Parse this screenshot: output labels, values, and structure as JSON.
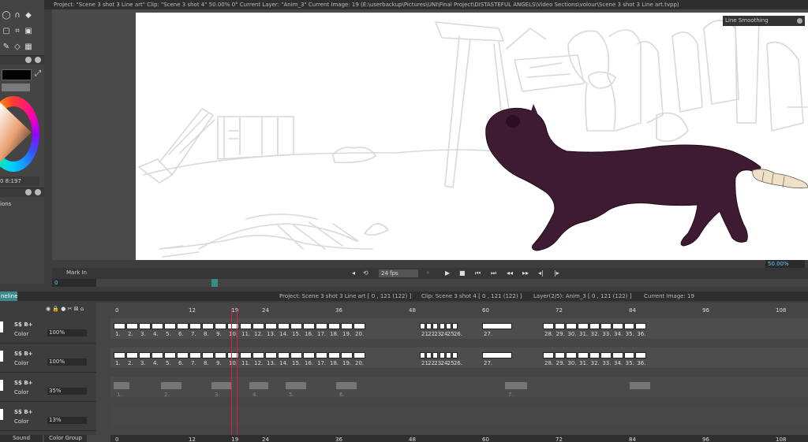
{
  "titlebar": "Project: \"Scene 3 shot 3 Line art\"  Clip: \"Scene 3 shot 4\"   50.00%   0°  Current Layer: \"Anim_3\"  Current Image: 19 (E:\\userbackup\\Pictures\\UNI\\Final Project\\DISTASTEFUL ANGELS\\Video Sections\\volour\\Scene 3 shot 3 Line art.tvpp)",
  "left": {
    "color_info": "0 8:197",
    "options_label": "ions"
  },
  "canvas": {
    "smoothing_label": "Line Smoothing",
    "zoom": "50.00%"
  },
  "playback": {
    "mark_in": "Mark In",
    "fps": "24 fps",
    "frame": "0"
  },
  "timeline_info": {
    "tab": "neline",
    "project": "Project: Scene 3 shot 3 Line art [ 0 , 121  (122) ]",
    "clip": "Clip: Scene 3 shot 4 [ 0 , 121  (122) ]",
    "layer": "Layer(2/5): Anim_3 [ 0 , 121  (122) ]",
    "image": "Current Image: 19"
  },
  "ruler_ticks": [
    "0",
    "12",
    "19",
    "24",
    "36",
    "48",
    "60",
    "72",
    "84",
    "96",
    "108"
  ],
  "layers": [
    {
      "meta": "S$ B+",
      "color": "Color",
      "opacity": "100%"
    },
    {
      "meta": "S$ B+",
      "color": "Color",
      "opacity": "100%"
    },
    {
      "meta": "S$ B+",
      "color": "Color",
      "opacity": "35%"
    },
    {
      "meta": "S$ B+",
      "color": "Color",
      "opacity": "13%"
    }
  ],
  "track1_nums": [
    "1.",
    "2.",
    "3.",
    "4.",
    "5.",
    "6.",
    "7.",
    "8.",
    "9.",
    "10.",
    "11.",
    "12.",
    "13.",
    "14.",
    "15.",
    "16.",
    "17.",
    "18.",
    "19.",
    "20.",
    "21.",
    "22.",
    "23.",
    "24.",
    "25.",
    "26.",
    "27.",
    "28.",
    "29.",
    "30.",
    "31.",
    "32.",
    "33.",
    "34.",
    "35.",
    "36."
  ],
  "track3_nums": [
    "1.",
    "2.",
    "3.",
    "4.",
    "5.",
    "6.",
    "7."
  ],
  "bottom_tabs": {
    "sound": "Sound",
    "color_group": "Color Group"
  },
  "colors": {
    "accent": "#3a8c8c",
    "playhead": "#dd2233",
    "character": "#3f1a33",
    "sketch": "#d9d9d9"
  }
}
